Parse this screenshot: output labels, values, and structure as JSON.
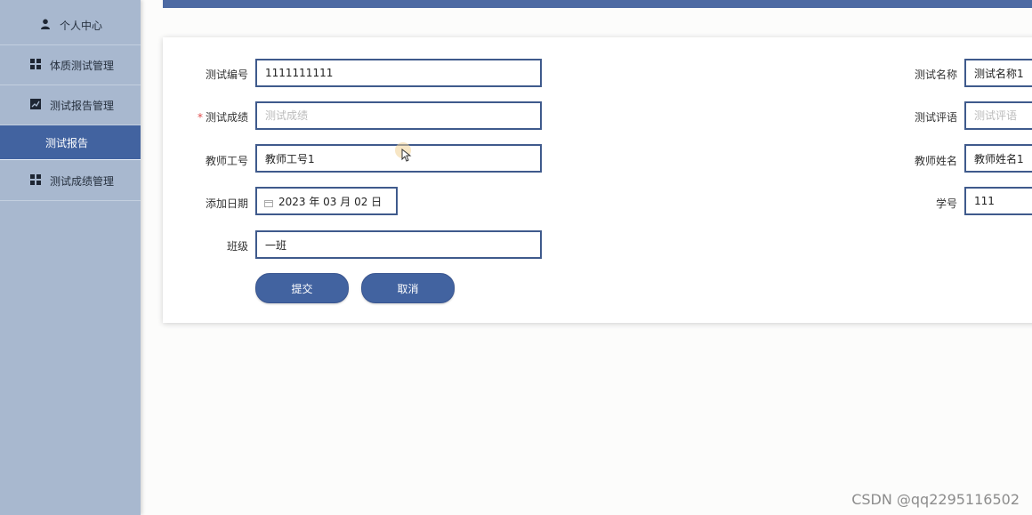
{
  "sidebar": {
    "items": [
      {
        "label": "个人中心",
        "icon": "user-icon"
      },
      {
        "label": "体质测试管理",
        "icon": "grid-icon"
      },
      {
        "label": "测试报告管理",
        "icon": "chart-icon"
      },
      {
        "label": "测试报告",
        "icon": ""
      },
      {
        "label": "测试成绩管理",
        "icon": "grid-icon"
      }
    ],
    "active_index": 3,
    "bg_color": "#a8b8cf",
    "active_color": "#4263a0"
  },
  "form": {
    "test_no": {
      "label": "测试编号",
      "value": "1111111111"
    },
    "test_name": {
      "label": "测试名称",
      "value": "测试名称1"
    },
    "test_score": {
      "label": "测试成绩",
      "required_mark": "*",
      "placeholder": "测试成绩",
      "value": ""
    },
    "test_comment": {
      "label": "测试评语",
      "placeholder": "测试评语",
      "value": ""
    },
    "teacher_no": {
      "label": "教师工号",
      "value": "教师工号1"
    },
    "teacher_name": {
      "label": "教师姓名",
      "value": "教师姓名1"
    },
    "add_date": {
      "label": "添加日期",
      "value": "2023 年 03 月 02 日"
    },
    "student_no": {
      "label": "学号",
      "value": "111"
    },
    "class_name": {
      "label": "班级",
      "value": "一班"
    }
  },
  "buttons": {
    "submit": "提交",
    "cancel": "取消"
  },
  "watermark": "CSDN @qq2295116502",
  "colors": {
    "accent": "#4263a0",
    "input_border": "#3f5a8c",
    "topbar": "#4d6aa3"
  }
}
